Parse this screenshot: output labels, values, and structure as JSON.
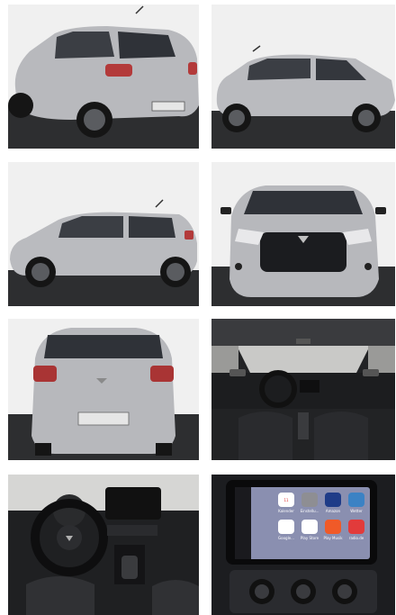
{
  "gallery": {
    "photos": [
      {
        "view": "rear three-quarter exterior"
      },
      {
        "view": "side profile from right"
      },
      {
        "view": "side profile from left"
      },
      {
        "view": "front exterior"
      },
      {
        "view": "rear exterior"
      },
      {
        "view": "interior dashboard"
      },
      {
        "view": "steering wheel and center console"
      },
      {
        "view": "infotainment screen with CarPlay"
      }
    ]
  },
  "carplay": {
    "apps": [
      "Kalender",
      "Einstellu...",
      "Amazon",
      "Wetter",
      "Google...",
      "Play Store",
      "Play Musik",
      "radio.de"
    ],
    "date": "11"
  },
  "colors": {
    "car_silver": "#b9babe",
    "background_white": "#f2f2f2",
    "floor_dark": "#2a2b2d",
    "interior_black": "#1b1b1d"
  }
}
